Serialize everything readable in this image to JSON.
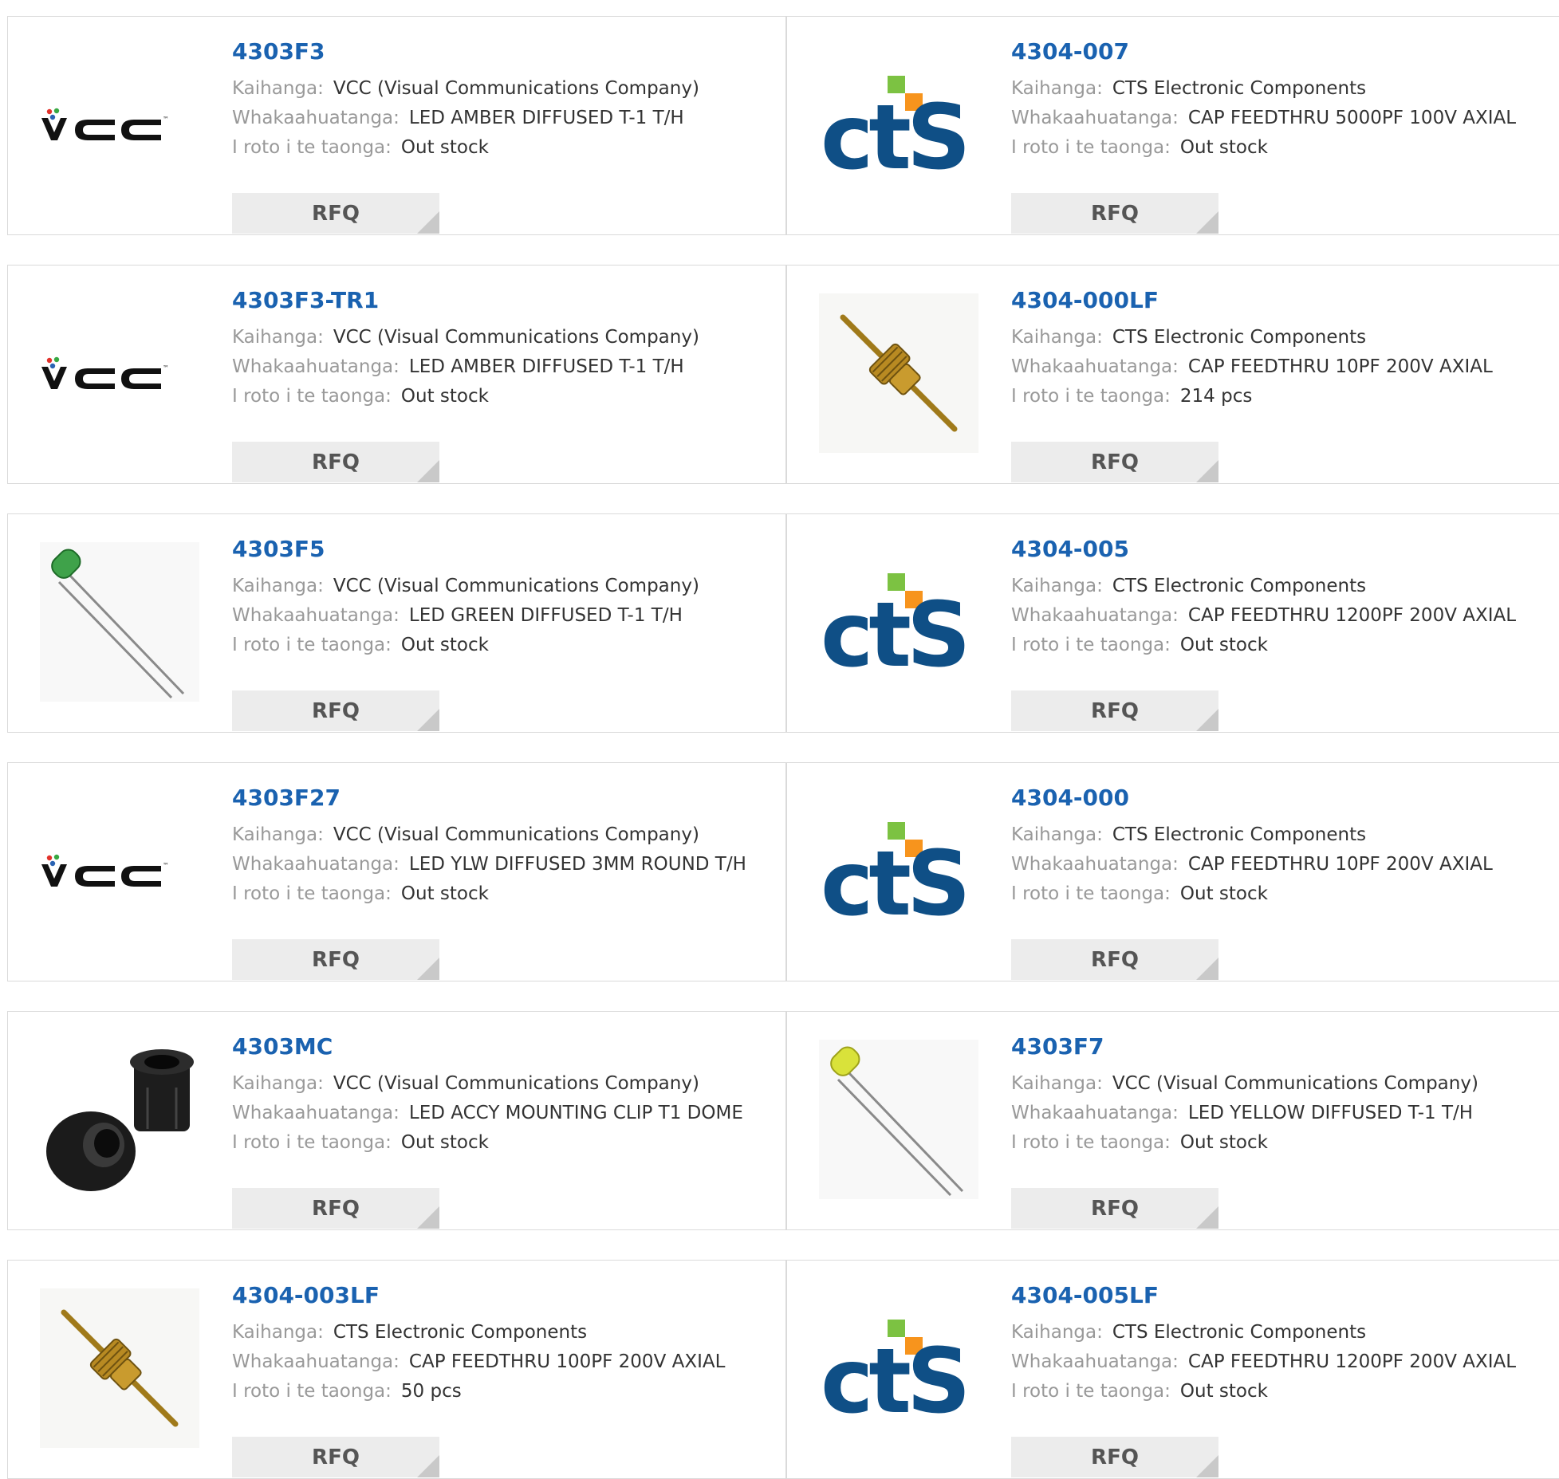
{
  "labels": {
    "manufacturer": "Kaihanga:",
    "description": "Whakaahuatanga:",
    "stock": "I roto i te taonga:",
    "rfq": "RFQ"
  },
  "brand_colors": {
    "link": "#1a62b0",
    "cts_blue": "#0f4f86",
    "cts_green": "#7cc242",
    "cts_orange": "#f7941d"
  },
  "logos": {
    "vcc": {
      "text": "VCC",
      "tm": "™"
    },
    "cts": {
      "text": "CTS"
    }
  },
  "products": [
    {
      "part": "4303F3",
      "manufacturer": "VCC (Visual Communications Company)",
      "description": "LED AMBER DIFFUSED T-1 T/H",
      "stock": "Out stock",
      "image": "vcc-logo"
    },
    {
      "part": "4304-007",
      "manufacturer": "CTS Electronic Components",
      "description": "CAP FEEDTHRU 5000PF 100V AXIAL",
      "stock": "Out stock",
      "image": "cts-logo"
    },
    {
      "part": "4303F3-TR1",
      "manufacturer": "VCC (Visual Communications Company)",
      "description": "LED AMBER DIFFUSED T-1 T/H",
      "stock": "Out stock",
      "image": "vcc-logo"
    },
    {
      "part": "4304-000LF",
      "manufacturer": "CTS Electronic Components",
      "description": "CAP FEEDTHRU 10PF 200V AXIAL",
      "stock": "214 pcs",
      "image": "feedthru-capacitor"
    },
    {
      "part": "4303F5",
      "manufacturer": "VCC (Visual Communications Company)",
      "description": "LED GREEN DIFFUSED T-1 T/H",
      "stock": "Out stock",
      "image": "green-led"
    },
    {
      "part": "4304-005",
      "manufacturer": "CTS Electronic Components",
      "description": "CAP FEEDTHRU 1200PF 200V AXIAL",
      "stock": "Out stock",
      "image": "cts-logo"
    },
    {
      "part": "4303F27",
      "manufacturer": "VCC (Visual Communications Company)",
      "description": "LED YLW DIFFUSED 3MM ROUND T/H",
      "stock": "Out stock",
      "image": "vcc-logo"
    },
    {
      "part": "4304-000",
      "manufacturer": "CTS Electronic Components",
      "description": "CAP FEEDTHRU 10PF 200V AXIAL",
      "stock": "Out stock",
      "image": "cts-logo"
    },
    {
      "part": "4303MC",
      "manufacturer": "VCC (Visual Communications Company)",
      "description": "LED ACCY MOUNTING CLIP T1 DOME",
      "stock": "Out stock",
      "image": "mounting-clip"
    },
    {
      "part": "4303F7",
      "manufacturer": "VCC (Visual Communications Company)",
      "description": "LED YELLOW DIFFUSED T-1 T/H",
      "stock": "Out stock",
      "image": "yellow-led"
    },
    {
      "part": "4304-003LF",
      "manufacturer": "CTS Electronic Components",
      "description": "CAP FEEDTHRU 100PF 200V AXIAL",
      "stock": "50 pcs",
      "image": "feedthru-capacitor"
    },
    {
      "part": "4304-005LF",
      "manufacturer": "CTS Electronic Components",
      "description": "CAP FEEDTHRU 1200PF 200V AXIAL",
      "stock": "Out stock",
      "image": "cts-logo"
    }
  ]
}
